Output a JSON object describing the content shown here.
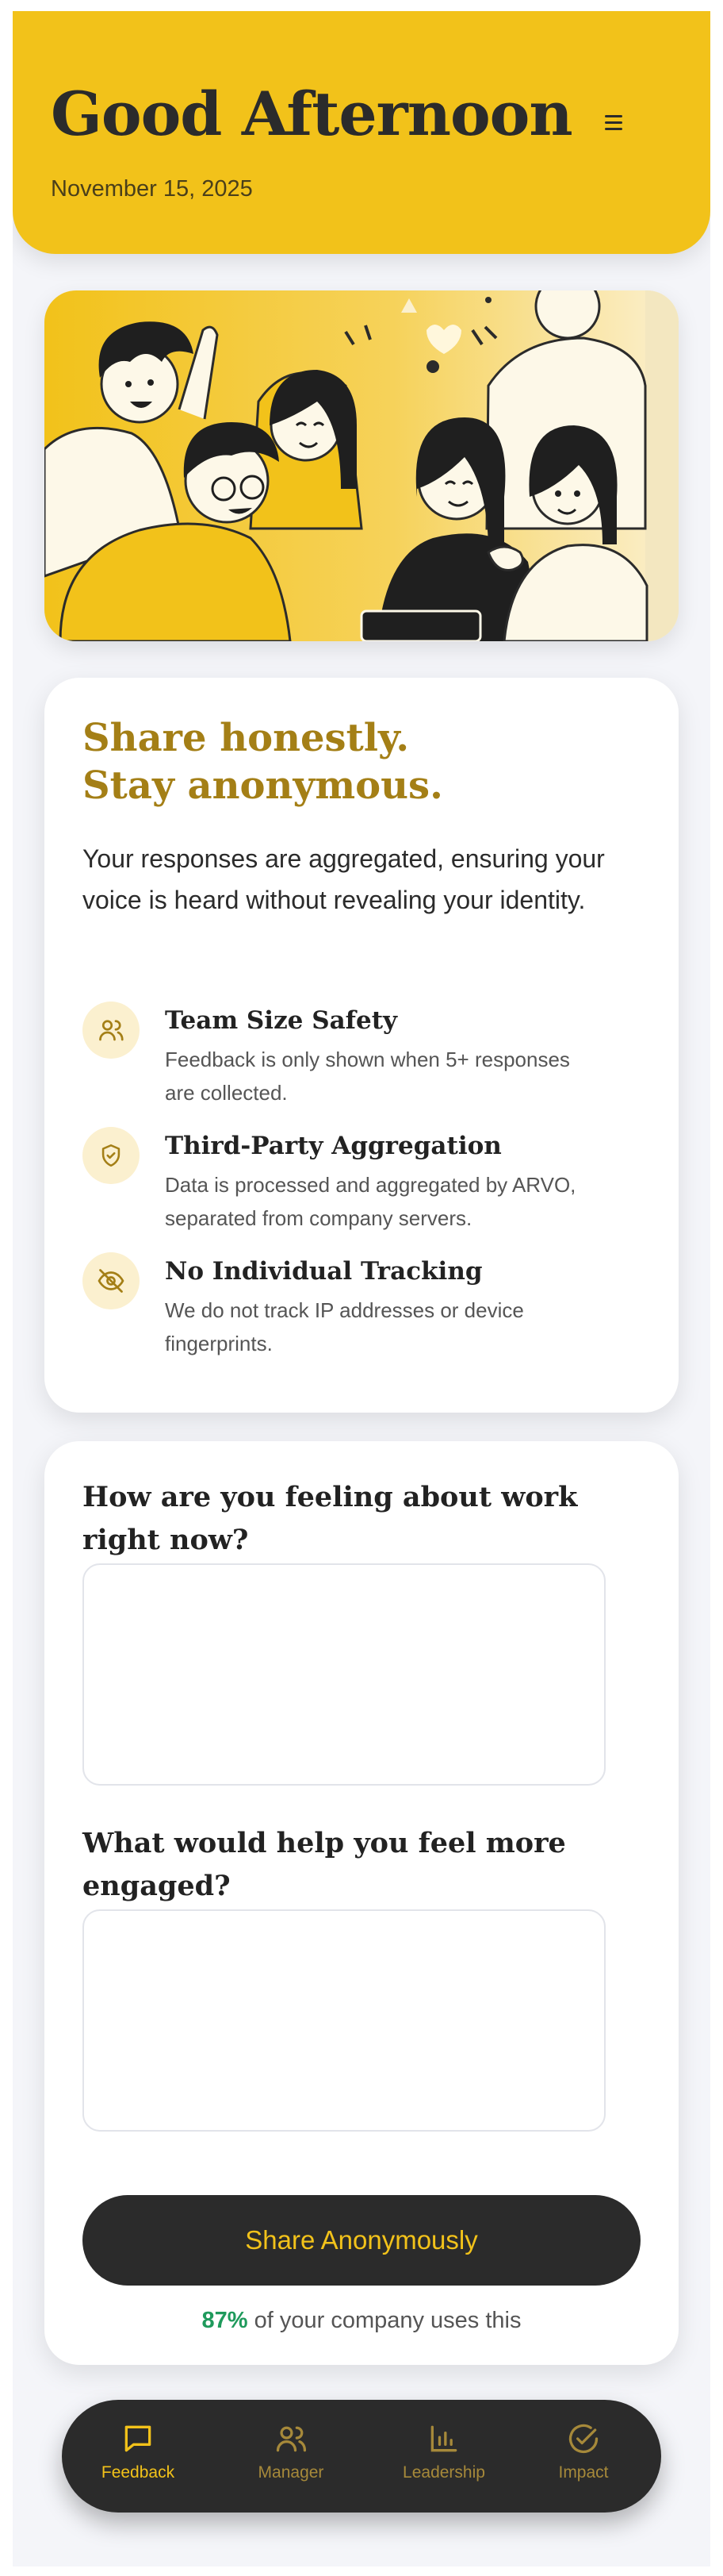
{
  "header": {
    "greeting": "Good Afternoon",
    "date": "November 15, 2025"
  },
  "info": {
    "title_line1": "Share honestly.",
    "title_line2": "Stay anonymous.",
    "description": "Your responses are aggregated, ensuring your voice is heard without revealing your identity.",
    "features": [
      {
        "icon": "users-icon",
        "title": "Team Size Safety",
        "description": "Feedback is only shown when 5+ responses are collected."
      },
      {
        "icon": "shield-check-icon",
        "title": "Third-Party Aggregation",
        "description": "Data is processed and aggregated by ARVO, separated from company servers."
      },
      {
        "icon": "eye-off-icon",
        "title": "No Individual Tracking",
        "description": "We do not track IP addresses or device fingerprints."
      }
    ]
  },
  "form": {
    "question1": "How are you feeling about work right now?",
    "answer1": "",
    "question2": "What would help you feel more engaged?",
    "answer2": "",
    "submit_label": "Share Anonymously",
    "usage_percent": "87%",
    "usage_text": " of your company uses this"
  },
  "nav": {
    "items": [
      {
        "label": "Feedback",
        "icon": "chat-icon",
        "active": true
      },
      {
        "label": "Manager",
        "icon": "users-icon",
        "active": false
      },
      {
        "label": "Leadership",
        "icon": "bar-chart-icon",
        "active": false
      },
      {
        "label": "Impact",
        "icon": "check-circle-icon",
        "active": false
      }
    ]
  },
  "colors": {
    "brand_yellow": "#f2c21a",
    "dark": "#2b2b2b",
    "accent_gold": "#a47f16",
    "success_green": "#1f9a5c",
    "background": "#f4f5f9"
  }
}
